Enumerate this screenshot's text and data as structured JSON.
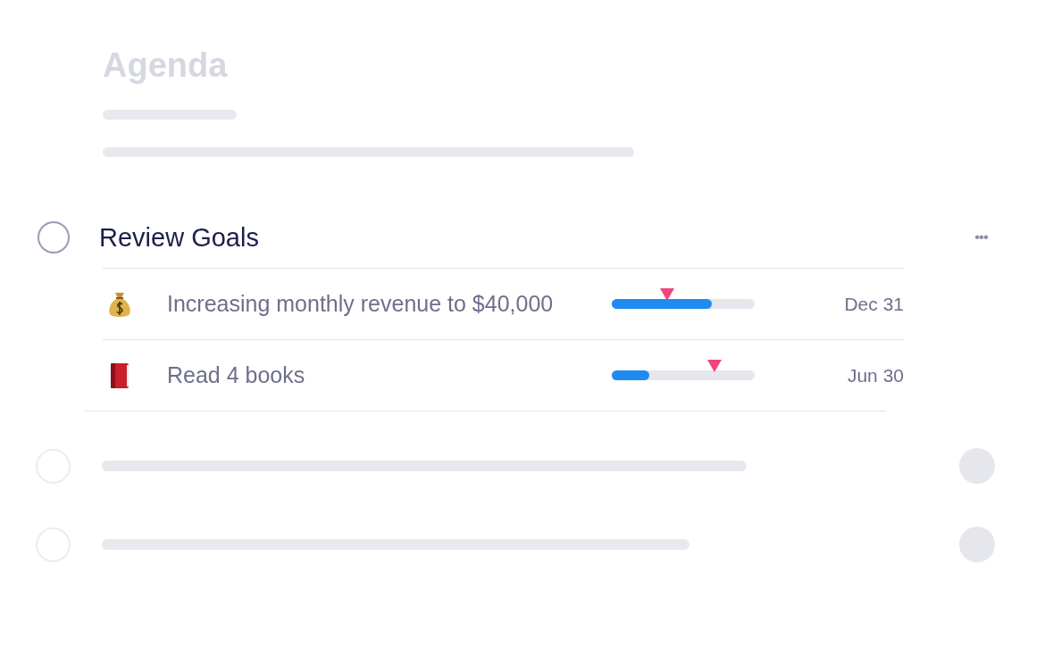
{
  "title": "Agenda",
  "task": {
    "title": "Review Goals",
    "checked": false,
    "more": "•••"
  },
  "goals": [
    {
      "kind": "money",
      "name": "Increasing monthly revenue to $40,000",
      "progress": {
        "level": 0.7
      },
      "expected": {
        "level": 0.39
      },
      "due": "Dec 31"
    },
    {
      "kind": "book",
      "name": "Read 4 books",
      "progress": {
        "level": 0.26
      },
      "expected": {
        "level": 0.72
      },
      "due": "Jun 30"
    }
  ],
  "placeholder_rows": [
    {
      "checked": false
    },
    {
      "checked": false
    }
  ]
}
